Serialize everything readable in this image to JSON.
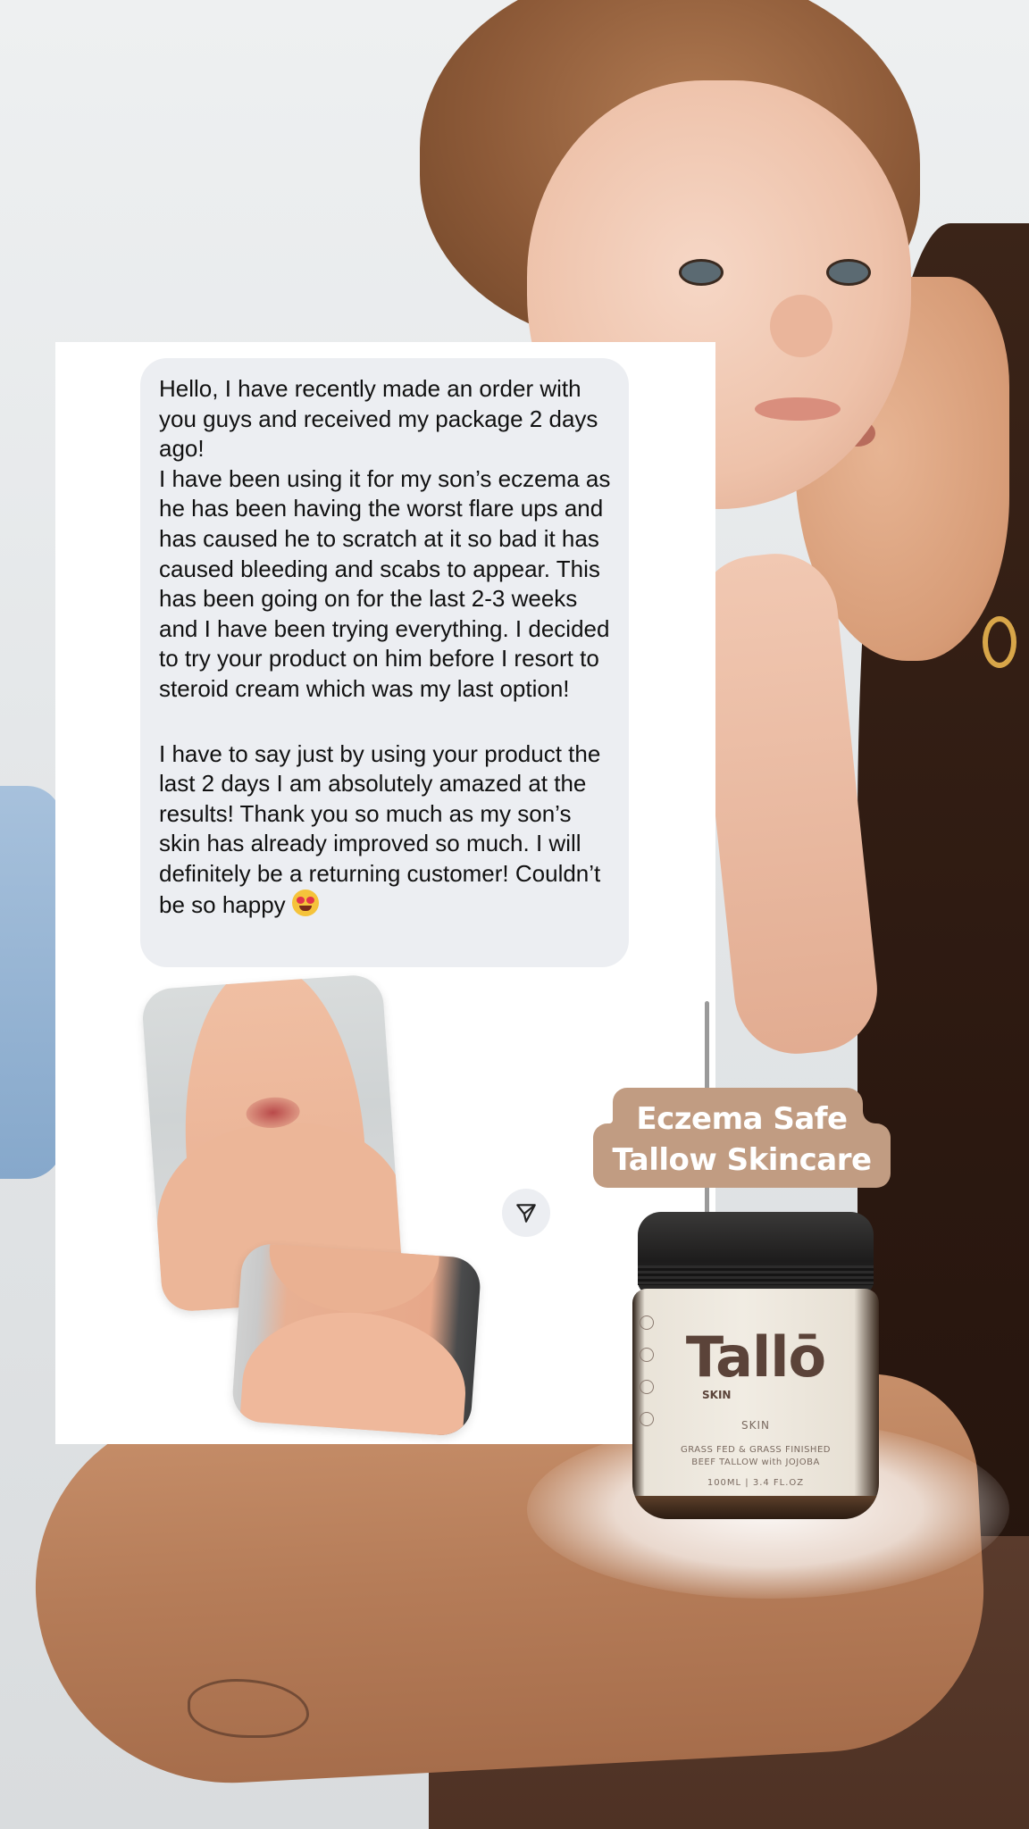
{
  "message": {
    "paragraphs": [
      "Hello, I have recently made an order with you guys and received my package 2 days ago!",
      "I have been using it for my son’s eczema as he has been having the worst flare ups and has caused he to scratch at it so bad it has caused bleeding and scabs to appear. This has been going on for the last 2-3 weeks and I have been trying everything. I decided to try your product on him before I resort to steroid cream which was my last option!",
      "I have to say just by using your product the last 2 days I am absolutely amazed at the results! Thank you so much as my son’s skin has already improved so much. I will definitely be a returning customer! Couldn’t be so happy"
    ],
    "emoji": "heart-eyes-emoji"
  },
  "icons": {
    "send": "send-icon"
  },
  "badge": {
    "line1": "Eczema Safe",
    "line2": "Tallow Skincare",
    "color": "#c19c82"
  },
  "product": {
    "brand": "Tallō",
    "brand_sub": "SKIN",
    "skin": "SKIN",
    "desc_line1": "GRASS FED & GRASS FINISHED",
    "desc_line2": "BEEF TALLOW with JOJOBA",
    "volume": "100ML | 3.4 FL.OZ"
  }
}
